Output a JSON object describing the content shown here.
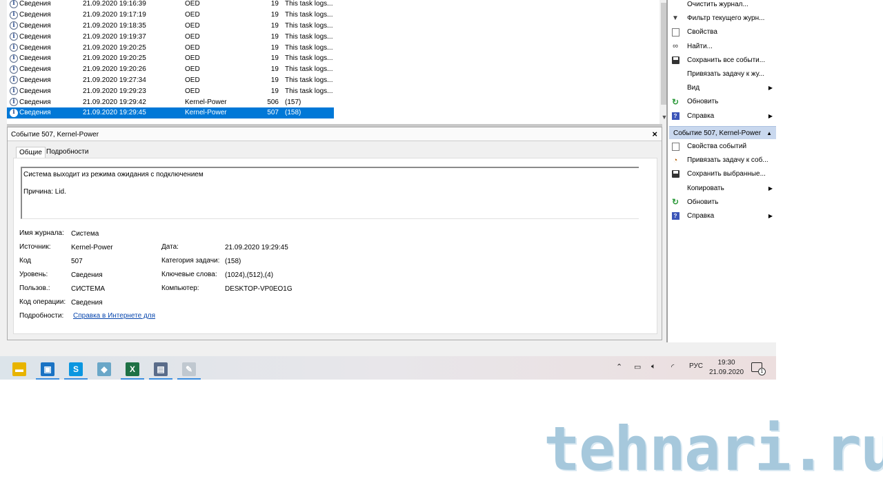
{
  "events": {
    "rows": [
      {
        "level": "Сведения",
        "date": "21.09.2020 19:16:39",
        "source": "OED",
        "id": "19",
        "category": "This task logs...",
        "selected": false
      },
      {
        "level": "Сведения",
        "date": "21.09.2020 19:17:19",
        "source": "OED",
        "id": "19",
        "category": "This task logs...",
        "selected": false
      },
      {
        "level": "Сведения",
        "date": "21.09.2020 19:18:35",
        "source": "OED",
        "id": "19",
        "category": "This task logs...",
        "selected": false
      },
      {
        "level": "Сведения",
        "date": "21.09.2020 19:19:37",
        "source": "OED",
        "id": "19",
        "category": "This task logs...",
        "selected": false
      },
      {
        "level": "Сведения",
        "date": "21.09.2020 19:20:25",
        "source": "OED",
        "id": "19",
        "category": "This task logs...",
        "selected": false
      },
      {
        "level": "Сведения",
        "date": "21.09.2020 19:20:25",
        "source": "OED",
        "id": "19",
        "category": "This task logs...",
        "selected": false
      },
      {
        "level": "Сведения",
        "date": "21.09.2020 19:20:26",
        "source": "OED",
        "id": "19",
        "category": "This task logs...",
        "selected": false
      },
      {
        "level": "Сведения",
        "date": "21.09.2020 19:27:34",
        "source": "OED",
        "id": "19",
        "category": "This task logs...",
        "selected": false
      },
      {
        "level": "Сведения",
        "date": "21.09.2020 19:29:23",
        "source": "OED",
        "id": "19",
        "category": "This task logs...",
        "selected": false
      },
      {
        "level": "Сведения",
        "date": "21.09.2020 19:29:42",
        "source": "Kernel-Power",
        "id": "506",
        "category": "(157)",
        "selected": false
      },
      {
        "level": "Сведения",
        "date": "21.09.2020 19:29:45",
        "source": "Kernel-Power",
        "id": "507",
        "category": "(158)",
        "selected": true
      }
    ]
  },
  "detail": {
    "title": "Событие 507, Kernel-Power",
    "tabs": [
      "Общие",
      "Подробности"
    ],
    "message_line1": "Система выходит из режима ожидания с подключением",
    "message_line2": "Причина: Lid.",
    "fields": {
      "log_label": "Имя журнала:",
      "log_value": "Система",
      "source_label": "Источник:",
      "source_value": "Kernel-Power",
      "code_label": "Код",
      "code_value": "507",
      "level_label": "Уровень:",
      "level_value": "Сведения",
      "user_label": "Пользов.:",
      "user_value": "СИСТЕМА",
      "opcode_label": "Код операции:",
      "opcode_value": "Сведения",
      "more_label": "Подробности:",
      "more_link": "Справка в Интернете для",
      "date_label": "Дата:",
      "date_value": "21.09.2020 19:29:45",
      "taskcat_label": "Категория задачи:",
      "taskcat_value": "(158)",
      "keywords_label": "Ключевые слова:",
      "keywords_value": "(1024),(512),(4)",
      "computer_label": "Компьютер:",
      "computer_value": "DESKTOP-VP0EO1G"
    }
  },
  "actions": {
    "top": [
      {
        "label": "Очистить журнал...",
        "icon": "none",
        "submenu": false
      },
      {
        "label": "Фильтр текущего журн...",
        "icon": "filter-icon",
        "submenu": false
      },
      {
        "label": "Свойства",
        "icon": "properties-icon",
        "submenu": false
      },
      {
        "label": "Найти...",
        "icon": "binoculars-icon",
        "submenu": false
      },
      {
        "label": "Сохранить все событи...",
        "icon": "save-icon",
        "submenu": false
      },
      {
        "label": "Привязать задачу к жу...",
        "icon": "none",
        "submenu": false
      },
      {
        "label": "Вид",
        "icon": "none",
        "submenu": true
      },
      {
        "label": "Обновить",
        "icon": "refresh-icon",
        "submenu": false
      },
      {
        "label": "Справка",
        "icon": "help-icon",
        "submenu": true
      }
    ],
    "section_title": "Событие 507, Kernel-Power",
    "event": [
      {
        "label": "Свойства событий",
        "icon": "properties-icon",
        "submenu": false
      },
      {
        "label": "Привязать задачу к соб...",
        "icon": "task-icon",
        "submenu": false
      },
      {
        "label": "Сохранить выбранные...",
        "icon": "save-icon",
        "submenu": false
      },
      {
        "label": "Копировать",
        "icon": "none",
        "submenu": true
      },
      {
        "label": "Обновить",
        "icon": "refresh-icon",
        "submenu": false
      },
      {
        "label": "Справка",
        "icon": "help-icon",
        "submenu": true
      }
    ]
  },
  "taskbar": {
    "apps": [
      {
        "name": "file-explorer-icon",
        "color": "#e8b400"
      },
      {
        "name": "remote-desktop-icon",
        "color": "#1a73c4"
      },
      {
        "name": "skype-icon",
        "color": "#0a96e0"
      },
      {
        "name": "notes-icon",
        "color": "#6aa7c8"
      },
      {
        "name": "excel-icon",
        "color": "#1e7145"
      },
      {
        "name": "event-viewer-icon",
        "color": "#5a6c8a"
      },
      {
        "name": "paint-icon",
        "color": "#c0c8d0"
      }
    ],
    "language": "РУС",
    "time": "19:30",
    "date": "21.09.2020",
    "notifications": "1"
  },
  "watermark": "tehnari.ru",
  "colors": {
    "selection": "#0078d7",
    "link": "#0645ad",
    "section_header": "#c9d8ee"
  }
}
